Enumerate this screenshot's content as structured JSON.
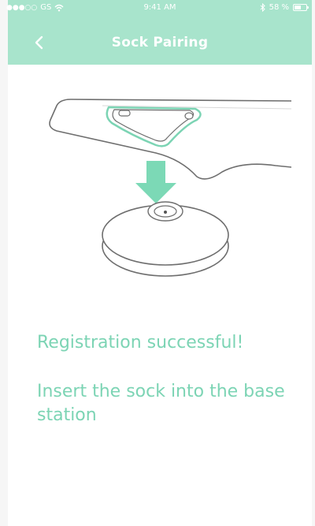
{
  "status_bar": {
    "signal": "●●●○○",
    "carrier": "GS",
    "time": "9:41 AM",
    "battery_text": "58 %",
    "battery_level": 0.58
  },
  "nav": {
    "title": "Sock Pairing",
    "back_icon": "chevron-left-icon"
  },
  "content": {
    "message_success": "Registration successful!",
    "message_instruction": "Insert the sock into the base station"
  },
  "colors": {
    "header": "#a8e4cc",
    "accent_text": "#7cd4b4",
    "arrow": "#7cd9b6",
    "background": "#ffffff"
  }
}
